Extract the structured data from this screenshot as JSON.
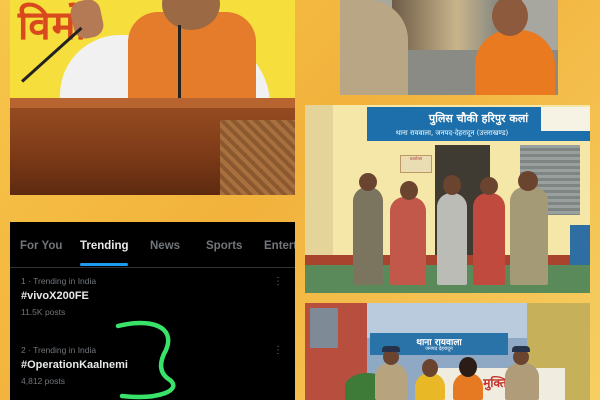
{
  "photos": {
    "podium": {
      "heading": "विमो"
    },
    "outpost": {
      "sign": "पुलिस चौकी हरिपुर कलां",
      "sign_sub": "थाना रायवाला, जनपद-देहरादून (उत्तराखण्ड)",
      "door_sign": "कार्यालय"
    },
    "station": {
      "sign": "थाना रायवाला",
      "sign_sub": "जनपद देहरादून",
      "banner": "मुक्ति"
    }
  },
  "trending": {
    "tabs": [
      "For You",
      "Trending",
      "News",
      "Sports",
      "Entert"
    ],
    "active_tab": "Trending",
    "items": [
      {
        "meta": "1 · Trending in India",
        "tag": "#vivoX200FE",
        "count": "11.5K posts"
      },
      {
        "meta": "2 · Trending in India",
        "tag": "#OperationKaalnemi",
        "count": "4,812 posts"
      }
    ],
    "more_icon": "⋮",
    "markup_color": "#39e36a",
    "accent": "#1d9bf0"
  }
}
